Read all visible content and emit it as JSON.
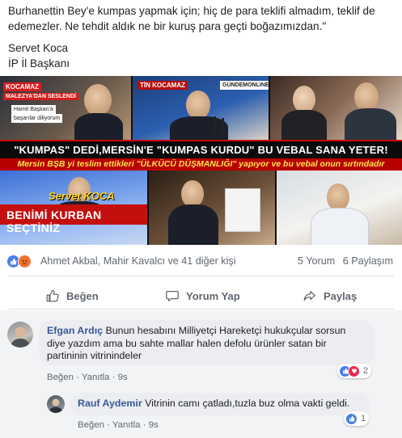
{
  "post": {
    "line1": "Burhanettin Bey'e kumpas yapmak için; hiç de para teklifi almadım, teklif de",
    "line2": "edemezler. Ne tehdit aldık ne bir kuruş para geçti boğazımızdan.\"",
    "signature_name": "Servet Koca",
    "signature_title": "İP İl Başkanı"
  },
  "image": {
    "tag_kocamaz": "KOCAMAZ",
    "tag_malezya": "MALEZYA'DAN SESLENDİ",
    "caption_baskan_1": "Hamit Başkan'a",
    "caption_baskan_2": "başarılar diliyorum",
    "tag_tin_kocamaz": "TİN KOCAMAZ",
    "tag_online": "GÜNDEMONLINE",
    "banner_text": "\"KUMPAS\" DEDİ,MERSİN'E \"KUMPAS KURDU\" BU VEBAL SANA YETER!",
    "sub_banner_text": "Mersin BŞB yi teslim ettikleri \"ÜLKÜCÜ DÜŞMANLIĞI\" yapıyor ve bu vebal onun sırtındadır",
    "name_overlay": "Servet KOCA",
    "kurban_text": "BENİMİ KURBAN SEÇTİNİZ"
  },
  "reactions": {
    "reactors": "Ahmet Akbal, Mahir Kavalcı ve 41 diğer kişi",
    "comments_count": "5 Yorum",
    "shares_count": "6 Paylaşım",
    "like_icon": "like-icon",
    "angry_icon": "angry-icon"
  },
  "actions": {
    "like": "Beğen",
    "comment": "Yorum Yap",
    "share": "Paylaş"
  },
  "comments": [
    {
      "author": "Efgan Ardıç",
      "text_line1": "Bunun hesabını Milliyetçi Hareketçi hukukçular sorsun",
      "text_line2": "diye yazdım ama bu sahte mallar halen defolu ürünler satan bir",
      "text_line3": "partininin vitrinindeler",
      "like_action": "Beğen",
      "reply_action": "Yanıtla",
      "time": "9s",
      "reaction_count": "2"
    },
    {
      "author": "Rauf Aydemir",
      "text_line1": "Vitrinin camı çatladı,tuzla buz olma vakti geldi.",
      "like_action": "Beğen",
      "reply_action": "Yanıtla",
      "time": "9s",
      "reaction_count": "1"
    }
  ],
  "colors": {
    "link_blue": "#385898",
    "like_blue": "#4a7ee8",
    "love_red": "#f0284a",
    "angry_orange": "#f0712c",
    "banner_red": "#c40f0f"
  }
}
